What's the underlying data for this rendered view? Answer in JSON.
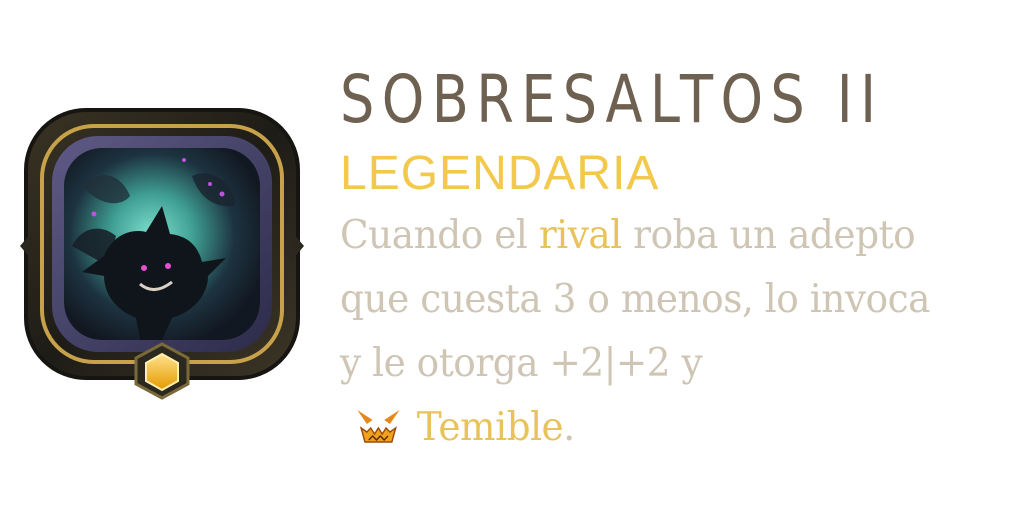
{
  "card": {
    "name": "SOBRESALTOS II",
    "rarity": "LEGENDARIA",
    "description": {
      "line1_a": "Cuando el ",
      "line1_keyword": "rival",
      "line1_b": " roba un adepto",
      "line2": "que cuesta 3 o menos, lo invoca",
      "line3": "y le otorga +2|+2 y",
      "keyword": "Temible",
      "keyword_suffix": "."
    },
    "keyword_icon": "fearsome-icon",
    "art_icon": "shadow-creature-art",
    "gem_icon": "hexagon-gem-icon",
    "colors": {
      "title": "#6e6151",
      "rarity": "#f2c94c",
      "description": "#cfc5b4",
      "keyword": "#e8c25a",
      "frame_gold": "#b08a3e",
      "art_bg": "#1f2a3a",
      "art_glow": "#4fb9a6",
      "gem": "#f4b400"
    }
  }
}
